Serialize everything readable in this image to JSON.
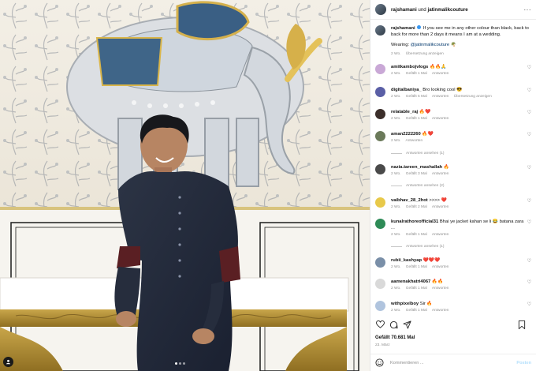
{
  "post": {
    "header": {
      "user1": "rajshamani",
      "connector": "und",
      "user2": "jatinmalikcouture",
      "more": "···"
    },
    "caption": {
      "user": "rajshamani",
      "text": "If you see me in any other colour than black, back to back for more than 2 days it means I am at a wedding.",
      "wearing_label": "Wearing:",
      "wearing_handle": "@jatinmalikcouture",
      "wearing_emoji": "🌴",
      "time": "2 Wo.",
      "translate": "Übersetzung anzeigen"
    },
    "comments": [
      {
        "user": "amitkambojvlogs",
        "text": "🔥🔥🙏",
        "time": "2 Wo.",
        "likes": "Gefällt 1 Mal",
        "reply": "Antworten",
        "avatar_color": "#c9a8d6"
      },
      {
        "user": "digitalbaniya_",
        "text": "Bro looking cool 😎",
        "time": "2 Wo.",
        "likes": "Gefällt 5 Mal",
        "reply": "Antworten",
        "translate": "Übersetzung anzeigen",
        "avatar_color": "#5a5fa6"
      },
      {
        "user": "relatable_raj",
        "text": "🔥❤️",
        "time": "2 Wo.",
        "likes": "Gefällt 1 Mal",
        "reply": "Antworten",
        "avatar_color": "#3b2e2a"
      },
      {
        "user": "aman2222260",
        "text": "🔥❤️",
        "time": "2 Wo.",
        "reply": "Antworten",
        "replies": "Antworten ansehen (1)",
        "avatar_color": "#6b7a5a"
      },
      {
        "user": "nazia.tareen_mashallah",
        "text": "🔥",
        "time": "2 Wo.",
        "likes": "Gefällt 3 Mal",
        "reply": "Antworten",
        "replies": "Antworten ansehen (2)",
        "avatar_color": "#4a4a4a"
      },
      {
        "user": "vaibhav_28_2hot",
        "text": ">>>> ❤️",
        "time": "2 Wo.",
        "likes": "Gefällt 2 Mal",
        "reply": "Antworten",
        "avatar_color": "#e8c94a"
      },
      {
        "user": "kunalrathoreofficial31",
        "text": "Bhai ye jacket kahan se li 😂 batana zara ...",
        "time": "2 Wo.",
        "likes": "Gefällt 1 Mal",
        "reply": "Antworten",
        "replies": "Antworten ansehen (1)",
        "avatar_color": "#2e8b57"
      },
      {
        "user": "rubii_kashyap",
        "text": "❤️❤️❤️",
        "time": "2 Wo.",
        "likes": "Gefällt 1 Mal",
        "reply": "Antworten",
        "avatar_color": "#7a8fa8"
      },
      {
        "user": "aamenakhatri4067",
        "text": "🔥🔥",
        "time": "2 Wo.",
        "likes": "Gefällt 1 Mal",
        "reply": "Antworten",
        "avatar_color": "#d9d9d9"
      },
      {
        "user": "withpixelboy",
        "text": "Sir 🔥",
        "time": "2 Wo.",
        "likes": "Gefällt 1 Mal",
        "reply": "Antworten",
        "avatar_color": "#b0c4de"
      }
    ],
    "likes": "Gefällt 70.681 Mal",
    "date": "23. März",
    "add_comment": {
      "placeholder": "Kommentieren ...",
      "post": "Posten"
    }
  },
  "icons": [
    "heart-icon",
    "comment-icon",
    "share-icon",
    "bookmark-icon",
    "emoji-icon",
    "user-tag-icon"
  ]
}
